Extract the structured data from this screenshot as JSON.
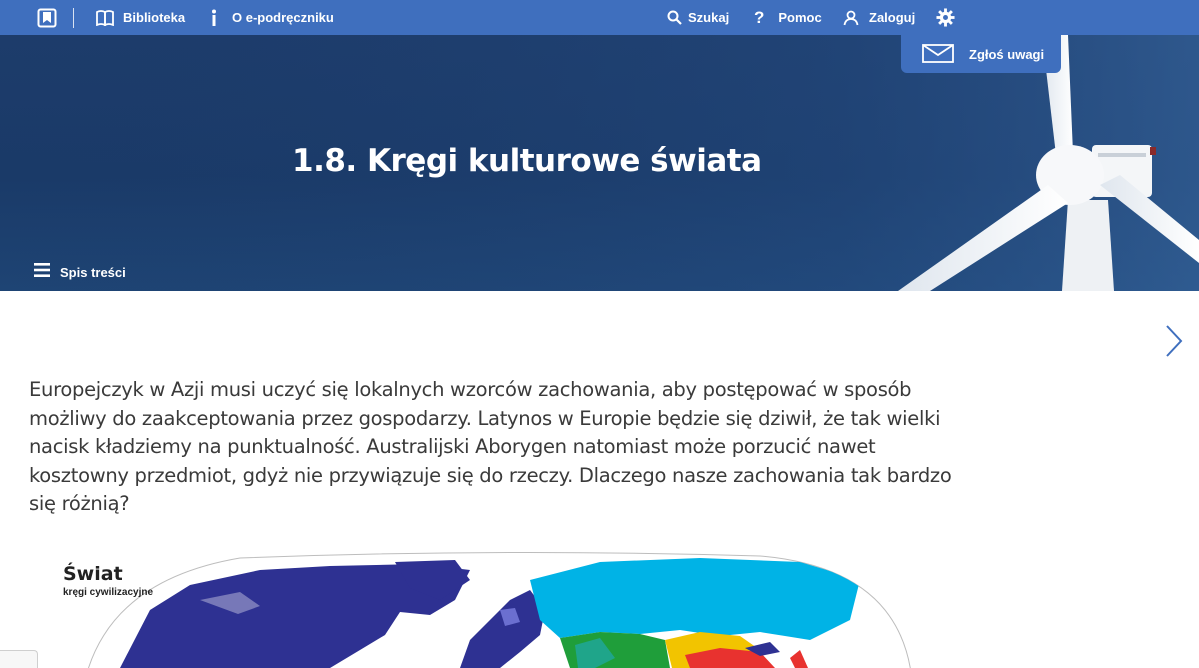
{
  "nav": {
    "biblioteka": "Biblioteka",
    "o_epodreczniku": "O e-podręczniku",
    "szukaj": "Szukaj",
    "pomoc": "Pomoc",
    "zaloguj": "Zaloguj"
  },
  "report": {
    "label": "Zgłoś uwagi"
  },
  "hero": {
    "title": "1.8. Kręgi kulturowe świata",
    "toc_label": "Spis treści"
  },
  "intro": "Europejczyk w Azji musi uczyć się lokalnych wzorców zachowania, aby postępować w sposób możliwy do zaakceptowania przez gospodarzy. Latynos w Europie będzie się dziwił, że tak wielki nacisk kładziemy na punktualność. Australijski Aborygen natomiast może porzucić nawet kosztowny przedmiot, gdyż nie przywiązuje się do rzeczy. Dlaczego nasze zachowania tak bardzo się różnią?",
  "map": {
    "title": "Świat",
    "subtitle": "kręgi cywilizacyjne"
  },
  "colors": {
    "nav_bg": "#3f6fbe",
    "hero_bg": "#1d3c6b",
    "text": "#3a3a3a",
    "arrow": "#3f6fbe",
    "map_western": "#2e3192",
    "map_orthodox": "#00b3e6",
    "map_islamic": "#1f9e3a",
    "map_sinic": "#ef3b3b",
    "map_buddhist": "#f2c400"
  },
  "icons": [
    "logo-icon",
    "book-icon",
    "info-icon",
    "search-icon",
    "help-icon",
    "user-icon",
    "gear-icon",
    "envelope-icon",
    "menu-icon",
    "chevron-right-icon"
  ]
}
